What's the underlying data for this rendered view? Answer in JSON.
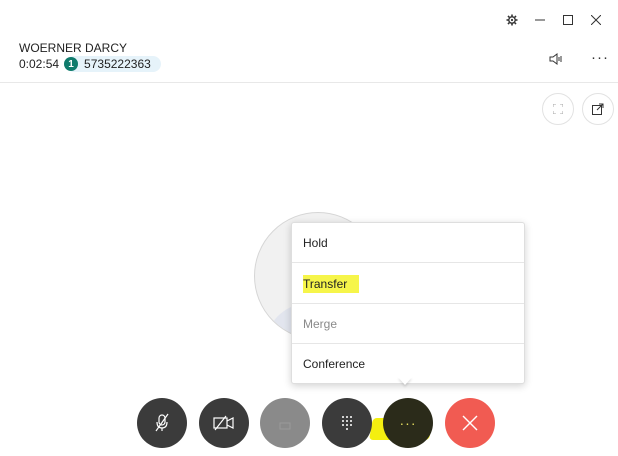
{
  "window": {
    "controls": [
      "gear-icon",
      "minimize-icon",
      "maximize-icon",
      "close-icon"
    ]
  },
  "call": {
    "caller_name": "WOERNER DARCY",
    "duration": "0:02:54",
    "line_badge": "1",
    "phone_number": "5735222363"
  },
  "header_icons": [
    "speaker-icon",
    "more-icon"
  ],
  "view_controls": [
    "fullscreen-icon",
    "popout-icon"
  ],
  "menu": {
    "items": [
      {
        "label": "Hold",
        "enabled": true
      },
      {
        "label": "Transfer",
        "enabled": true,
        "highlighted": true
      },
      {
        "label": "Merge",
        "enabled": false
      },
      {
        "label": "Conference",
        "enabled": true
      }
    ]
  },
  "controls": [
    {
      "name": "mute-button",
      "icon": "mic-off-icon"
    },
    {
      "name": "video-button",
      "icon": "camera-off-icon"
    },
    {
      "name": "hold-button",
      "icon": "hold-icon",
      "disabled": true
    },
    {
      "name": "dialpad-button",
      "icon": "dialpad-icon"
    },
    {
      "name": "more-options-button",
      "icon": "ellipsis-icon",
      "active": true
    },
    {
      "name": "hang-up-button",
      "icon": "close-icon"
    }
  ],
  "colors": {
    "accent": "#0f7b6c",
    "hangup": "#f15b52",
    "control": "#3b3b3b",
    "highlight": "#f6f54a"
  }
}
